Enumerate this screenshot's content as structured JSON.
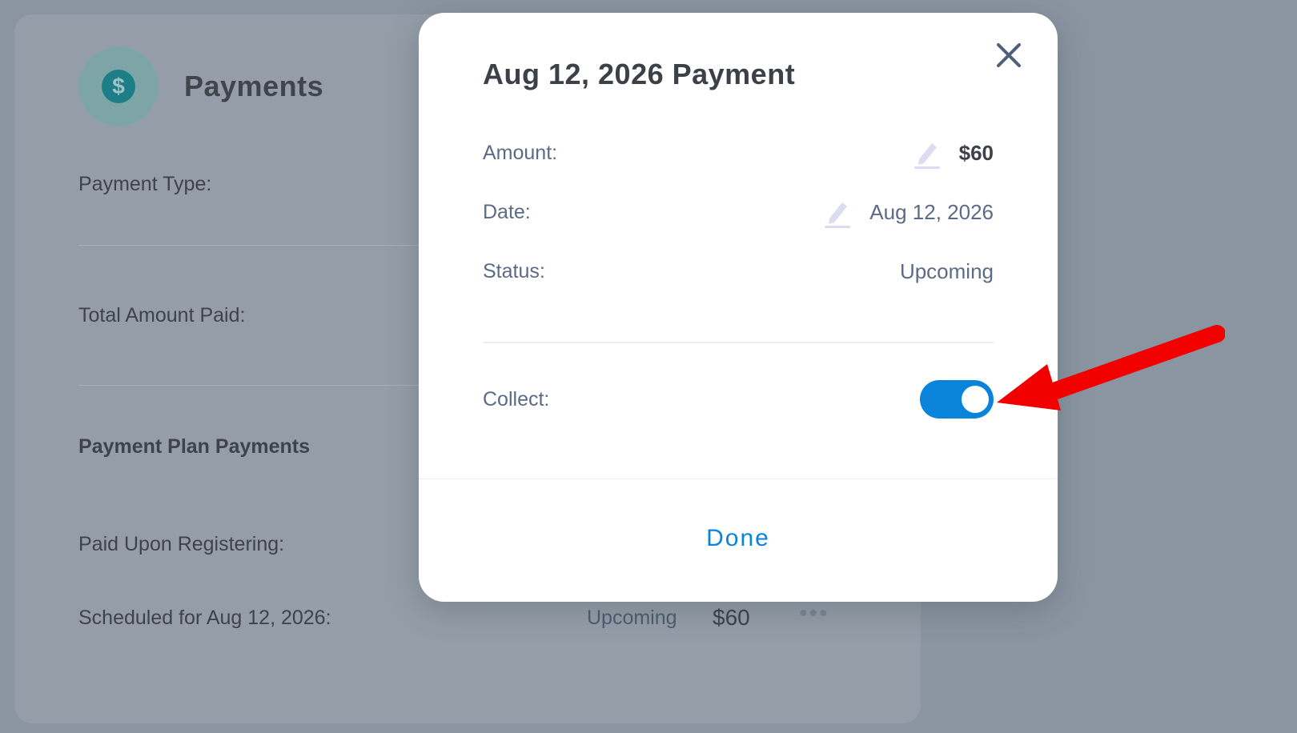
{
  "background": {
    "title": "Payments",
    "icon": "dollar-icon",
    "payment_type_label": "Payment Type:",
    "total_amount_paid_label": "Total Amount Paid:",
    "plan_payments_heading": "Payment Plan Payments",
    "paid_upon_registering_label": "Paid Upon Registering:",
    "scheduled_label": "Scheduled for Aug 12, 2026:",
    "scheduled_status": "Upcoming",
    "scheduled_amount": "$60",
    "more_icon": "more-dots-icon"
  },
  "modal": {
    "title": "Aug 12, 2026 Payment",
    "close_icon": "close-icon",
    "amount_label": "Amount:",
    "amount_value": "$60",
    "date_label": "Date:",
    "date_value": "Aug 12, 2026",
    "status_label": "Status:",
    "status_value": "Upcoming",
    "collect_label": "Collect:",
    "collect_enabled": true,
    "done_label": "Done",
    "edit_icon": "pencil-icon"
  },
  "colors": {
    "accent": "#0a84db",
    "overlay": "#8a95a1",
    "annotation_arrow": "#f20000"
  }
}
